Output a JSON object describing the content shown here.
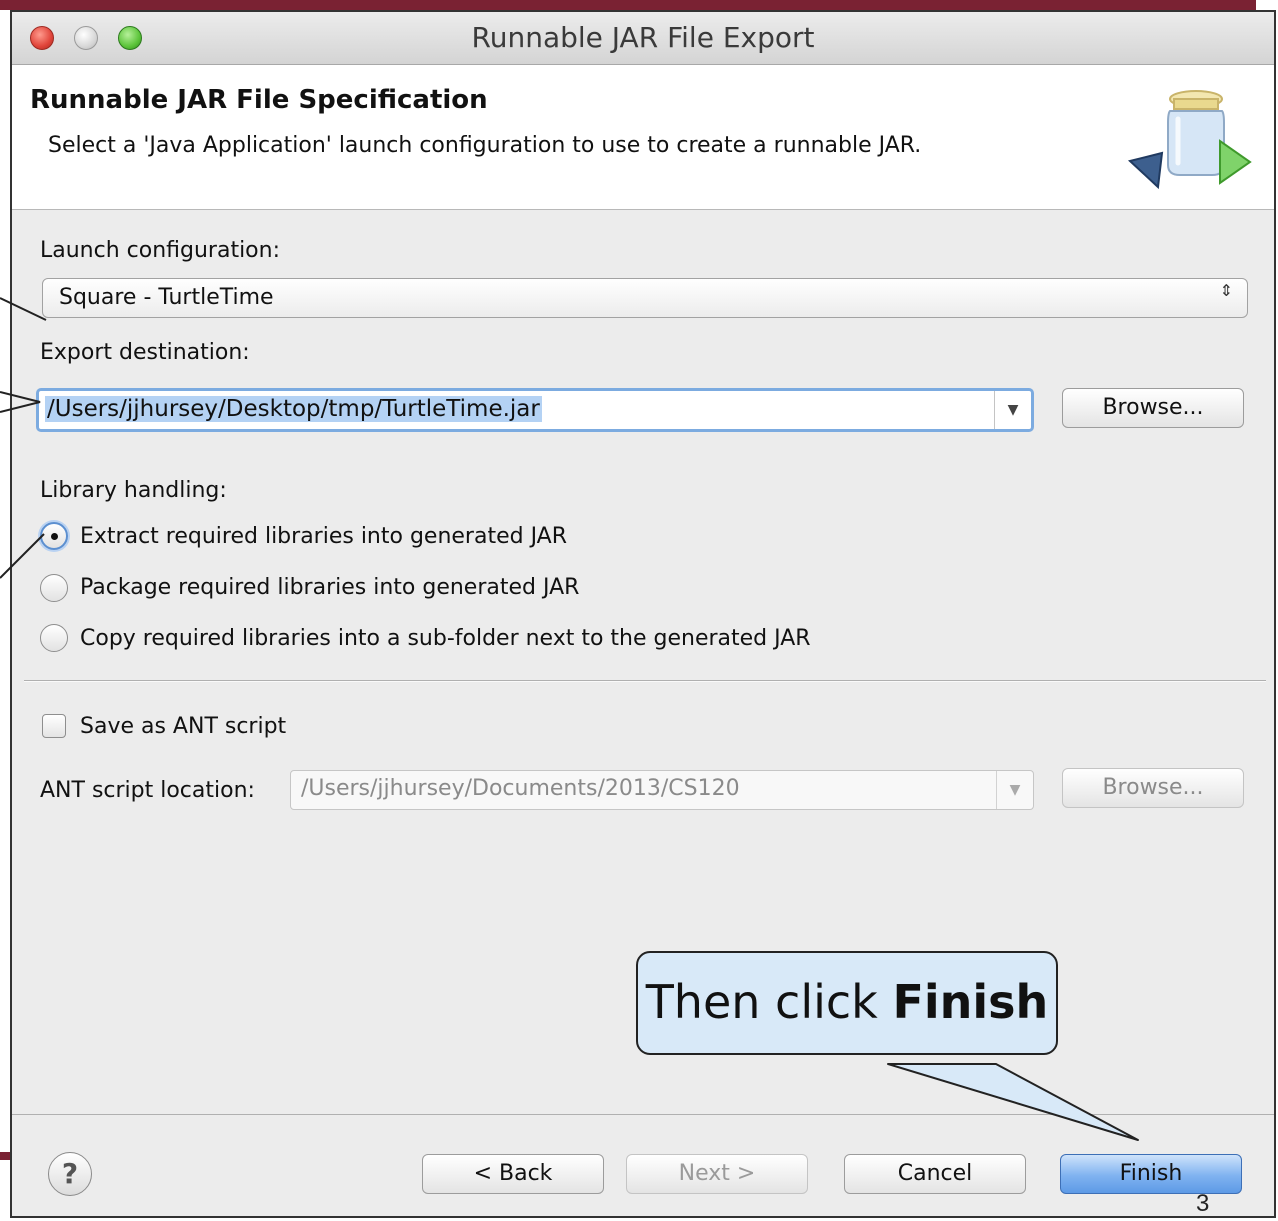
{
  "window": {
    "title": "Runnable JAR File Export"
  },
  "header": {
    "heading": "Runnable JAR File Specification",
    "description": "Select a 'Java Application' launch configuration to use to create a runnable JAR."
  },
  "launch": {
    "label": "Launch configuration:",
    "value": "Square - TurtleTime",
    "arrows": "⇕"
  },
  "export": {
    "label": "Export destination:",
    "value": "/Users/jjhursey/Desktop/tmp/TurtleTime.jar",
    "browse_label": "Browse...",
    "drop_glyph": "▼"
  },
  "library": {
    "label": "Library handling:",
    "options": [
      {
        "label": "Extract required libraries into generated JAR",
        "selected": true
      },
      {
        "label": "Package required libraries into generated JAR",
        "selected": false
      },
      {
        "label": "Copy required libraries into a sub-folder next to the generated JAR",
        "selected": false
      }
    ]
  },
  "ant": {
    "checkbox_label": "Save as ANT script",
    "checked": false,
    "location_label": "ANT script location:",
    "location_value": "/Users/jjhursey/Documents/2013/CS120",
    "browse_label": "Browse...",
    "drop_glyph": "▼"
  },
  "footer": {
    "help_glyph": "?",
    "back_label": "< Back",
    "next_label": "Next >",
    "cancel_label": "Cancel",
    "finish_label": "Finish"
  },
  "callout": {
    "prefix": "Then click ",
    "emphasis": "Finish"
  },
  "slide": {
    "number": "3"
  },
  "colors": {
    "accent_bar": "#7a2233",
    "focus_ring": "#7cabe0",
    "selection": "#b4d2f4",
    "default_button": "#7fb2f0",
    "callout_fill": "#d8e9f8"
  },
  "icons": {
    "header_art": "jar-with-arrows-icon",
    "help": "question-icon"
  }
}
